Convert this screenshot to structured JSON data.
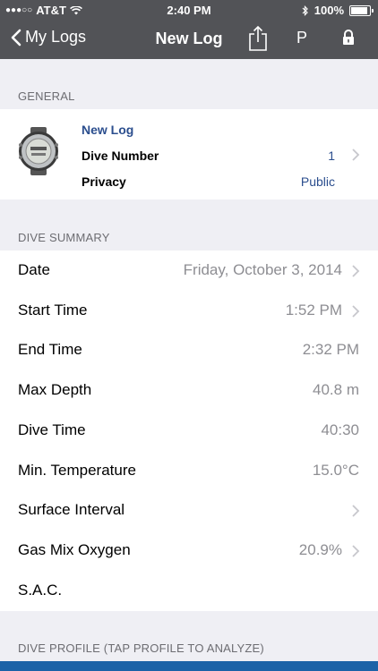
{
  "status_bar": {
    "carrier": "AT&T",
    "time": "2:40 PM",
    "battery": "100%",
    "battery_level": 1.0
  },
  "nav": {
    "back_label": "My Logs",
    "title": "New Log",
    "p_label": "P"
  },
  "general": {
    "header": "GENERAL",
    "name": "New Log",
    "dive_number_label": "Dive Number",
    "dive_number_value": "1",
    "privacy_label": "Privacy",
    "privacy_value": "Public"
  },
  "dive_summary": {
    "header": "DIVE SUMMARY",
    "rows": [
      {
        "label": "Date",
        "value": "Friday, October 3, 2014",
        "chevron": true
      },
      {
        "label": "Start Time",
        "value": "1:52 PM",
        "chevron": true
      },
      {
        "label": "End Time",
        "value": "2:32 PM",
        "chevron": false
      },
      {
        "label": "Max Depth",
        "value": "40.8 m",
        "chevron": false
      },
      {
        "label": "Dive Time",
        "value": "40:30",
        "chevron": false
      },
      {
        "label": "Min. Temperature",
        "value": "15.0°C",
        "chevron": false
      },
      {
        "label": "Surface Interval",
        "value": "",
        "chevron": true
      },
      {
        "label": "Gas Mix Oxygen",
        "value": "20.9%",
        "chevron": true
      },
      {
        "label": "S.A.C.",
        "value": "",
        "chevron": false
      }
    ]
  },
  "dive_profile": {
    "header": "DIVE PROFILE (TAP PROFILE TO ANALYZE)"
  },
  "colors": {
    "nav_bar": "#525357",
    "link_blue": "#2b4e8e",
    "profile_bar": "#1c62a7"
  }
}
